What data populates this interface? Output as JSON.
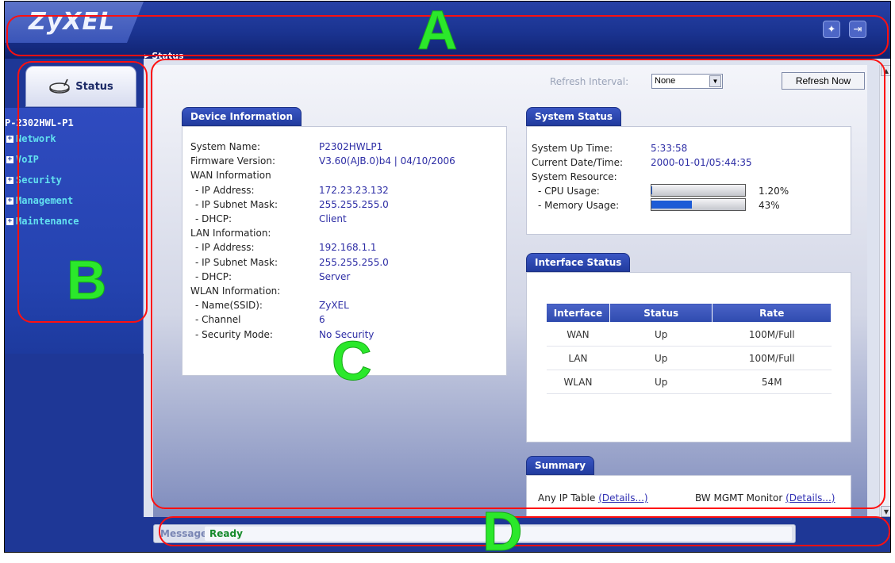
{
  "header": {
    "logo": "ZyXEL",
    "wizard_icon": "wizard-icon",
    "logout_icon": "logout-icon"
  },
  "breadcrumb": "Status",
  "sidebar": {
    "status_tab": "Status",
    "device_name": "P-2302HWL-P1",
    "items": [
      {
        "label": "Network"
      },
      {
        "label": "VoIP"
      },
      {
        "label": "Security"
      },
      {
        "label": "Management"
      },
      {
        "label": "Maintenance"
      }
    ]
  },
  "toolbar": {
    "refresh_interval_label": "Refresh Interval:",
    "refresh_interval_value": "None",
    "refresh_now": "Refresh Now"
  },
  "device_info": {
    "title": "Device Information",
    "rows": [
      {
        "k": "System Name:",
        "v": "P2302HWLP1"
      },
      {
        "k": "Firmware Version:",
        "v": "V3.60(AJB.0)b4 | 04/10/2006"
      },
      {
        "k": "WAN Information",
        "v": ""
      },
      {
        "k": "- IP Address:",
        "v": "172.23.23.132"
      },
      {
        "k": "- IP Subnet Mask:",
        "v": "255.255.255.0"
      },
      {
        "k": "- DHCP:",
        "v": "Client"
      },
      {
        "k": "LAN Information:",
        "v": ""
      },
      {
        "k": "- IP Address:",
        "v": "192.168.1.1"
      },
      {
        "k": "- IP Subnet Mask:",
        "v": "255.255.255.0"
      },
      {
        "k": "- DHCP:",
        "v": "Server"
      },
      {
        "k": "WLAN Information:",
        "v": ""
      },
      {
        "k": "- Name(SSID):",
        "v": "ZyXEL"
      },
      {
        "k": "- Channel",
        "v": "6"
      },
      {
        "k": "- Security Mode:",
        "v": "No Security"
      }
    ]
  },
  "system_status": {
    "title": "System Status",
    "up_time_label": "System Up Time:",
    "up_time": "5:33:58",
    "date_label": "Current Date/Time:",
    "date": "2000-01-01/05:44:35",
    "resource_label": "System Resource:",
    "cpu_label": "- CPU Usage:",
    "cpu_value": "1.20%",
    "cpu_percent": 1.2,
    "memory_label": "- Memory Usage:",
    "memory_value": "43%",
    "memory_percent": 43
  },
  "interface_status": {
    "title": "Interface Status",
    "columns": [
      "Interface",
      "Status",
      "Rate"
    ],
    "rows": [
      [
        "WAN",
        "Up",
        "100M/Full"
      ],
      [
        "LAN",
        "Up",
        "100M/Full"
      ],
      [
        "WLAN",
        "Up",
        "54M"
      ]
    ]
  },
  "summary": {
    "title": "Summary",
    "any_ip_label": "Any IP Table",
    "details": "(Details...)",
    "bw_label": "BW MGMT Monitor"
  },
  "message": {
    "label": "Message",
    "value": "Ready"
  },
  "annotations": [
    "A",
    "B",
    "C",
    "D"
  ],
  "colors": {
    "brand_blue": "#1e3796",
    "callout_red": "#ff1010",
    "annotation_green": "#2be82b",
    "ready_green": "#158a2a"
  }
}
